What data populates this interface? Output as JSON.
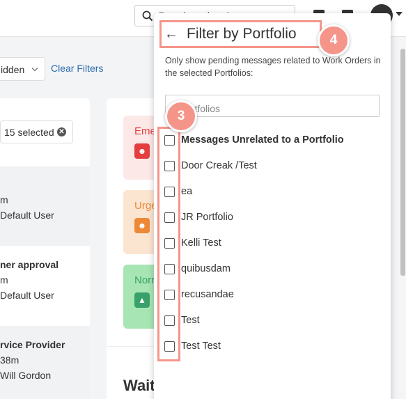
{
  "topbar": {
    "search_placeholder": "Search work orders"
  },
  "filters": {
    "hidden_label": "idden",
    "clear_label": "Clear Filters",
    "selected_label": "15 selected",
    "clear_selected_glyph": "✕"
  },
  "left_list": {
    "rows": [
      {
        "line1": "m",
        "line2": "Default User"
      },
      {
        "line0": "ner approval",
        "line1": "m",
        "line2": "Default User"
      },
      {
        "line0": "rvice Provider",
        "line1": "38m",
        "line2": "Will Gordon"
      }
    ]
  },
  "priorities": [
    {
      "label": "Eme",
      "icon": "☻",
      "text_color": "#e53e3e",
      "bg": "#fde8e8",
      "icon_bg": "#e53e3e"
    },
    {
      "label": "Urge",
      "icon": "☻",
      "text_color": "#ed8936",
      "bg": "#fbe5d1",
      "icon_bg": "#ed8936"
    },
    {
      "label": "Norr",
      "icon": "▲",
      "text_color": "#38a169",
      "bg": "#a8e5b4",
      "icon_bg": "#38a169"
    }
  ],
  "wait_heading": "Wait",
  "panel": {
    "back_glyph": "←",
    "title": "Filter by Portfolio",
    "description": "Only show pending messages related to Work Orders in the selected Portfolios:",
    "search_value": "h Portfolios",
    "items": [
      "Messages Unrelated to a Portfolio",
      "Door Creak /Test",
      "ea",
      "JR Portfolio",
      "Kelli Test",
      "quibusdam",
      "recusandae",
      "Test",
      "Test Test"
    ]
  },
  "annotations": {
    "badge_3": "3",
    "badge_4": "4",
    "accent": "#f5958a"
  }
}
